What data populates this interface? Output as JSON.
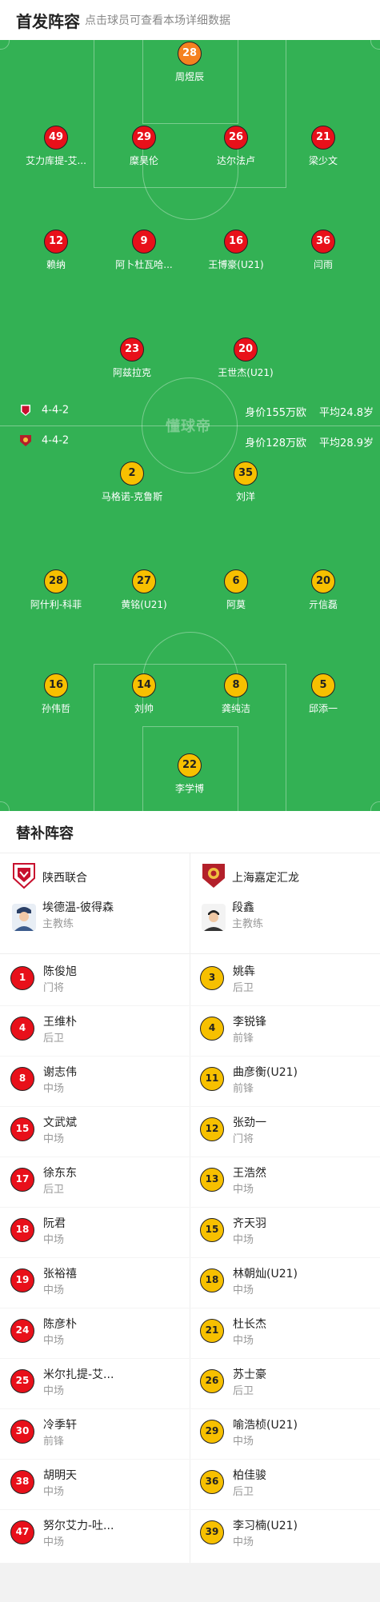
{
  "header": {
    "title": "首发阵容",
    "hint": "点击球员可查看本场详细数据"
  },
  "pitch": {
    "watermark": "懂球帝",
    "home": {
      "formation": "4-4-2",
      "value": "身价155万欧",
      "age": "平均24.8岁",
      "crest_color": "#c8102e"
    },
    "away": {
      "formation": "4-4-2",
      "value": "身价128万欧",
      "age": "平均28.9岁",
      "crest_color": "#b3202a"
    },
    "home_players": [
      {
        "num": "28",
        "name": "周煜辰",
        "color": "orange",
        "ball": false
      },
      {
        "num": "49",
        "name": "艾力库提-艾...",
        "color": "red",
        "ball": false
      },
      {
        "num": "29",
        "name": "糜昊伦",
        "color": "red",
        "ball": true
      },
      {
        "num": "26",
        "name": "达尔法卢",
        "color": "red",
        "ball": true
      },
      {
        "num": "21",
        "name": "梁少文",
        "color": "red",
        "ball": false
      },
      {
        "num": "12",
        "name": "赖纳",
        "color": "red",
        "ball": false
      },
      {
        "num": "9",
        "name": "阿卜杜瓦哈...",
        "color": "red",
        "ball": false
      },
      {
        "num": "16",
        "name": "王博豪(U21)",
        "color": "red",
        "ball": false
      },
      {
        "num": "36",
        "name": "闫雨",
        "color": "red",
        "ball": false
      },
      {
        "num": "23",
        "name": "阿兹拉克",
        "color": "red",
        "ball": false
      },
      {
        "num": "20",
        "name": "王世杰(U21)",
        "color": "red",
        "ball": false
      }
    ],
    "away_players": [
      {
        "num": "2",
        "name": "马格诺-克鲁斯",
        "color": "yellow",
        "ball": false
      },
      {
        "num": "35",
        "name": "刘洋",
        "color": "yellow",
        "ball": false
      },
      {
        "num": "28",
        "name": "阿什利-科菲",
        "color": "yellow",
        "ball": false
      },
      {
        "num": "27",
        "name": "黄铭(U21)",
        "color": "yellow",
        "ball": false
      },
      {
        "num": "6",
        "name": "阿莫",
        "color": "yellow",
        "ball": true
      },
      {
        "num": "20",
        "name": "亓信磊",
        "color": "yellow",
        "ball": false
      },
      {
        "num": "16",
        "name": "孙伟哲",
        "color": "yellow",
        "ball": false
      },
      {
        "num": "14",
        "name": "刘帅",
        "color": "yellow",
        "ball": false
      },
      {
        "num": "8",
        "name": "龚纯洁",
        "color": "yellow",
        "ball": false
      },
      {
        "num": "5",
        "name": "邱添一",
        "color": "yellow",
        "ball": false
      },
      {
        "num": "22",
        "name": "李学博",
        "color": "yellow",
        "ball": false
      }
    ]
  },
  "subs": {
    "title": "替补阵容",
    "home": {
      "team": "陕西联合",
      "coach": {
        "name": "埃德温-彼得森",
        "role": "主教练"
      },
      "players": [
        {
          "num": "1",
          "name": "陈俊旭",
          "pos": "门将"
        },
        {
          "num": "4",
          "name": "王维朴",
          "pos": "后卫"
        },
        {
          "num": "8",
          "name": "谢志伟",
          "pos": "中场"
        },
        {
          "num": "15",
          "name": "文武斌",
          "pos": "中场"
        },
        {
          "num": "17",
          "name": "徐东东",
          "pos": "后卫"
        },
        {
          "num": "18",
          "name": "阮君",
          "pos": "中场"
        },
        {
          "num": "19",
          "name": "张裕禧",
          "pos": "中场"
        },
        {
          "num": "24",
          "name": "陈彦朴",
          "pos": "中场"
        },
        {
          "num": "25",
          "name": "米尔扎提-艾...",
          "pos": "中场"
        },
        {
          "num": "30",
          "name": "冷季轩",
          "pos": "前锋"
        },
        {
          "num": "38",
          "name": "胡明天",
          "pos": "中场"
        },
        {
          "num": "47",
          "name": "努尔艾力-吐...",
          "pos": "中场"
        }
      ]
    },
    "away": {
      "team": "上海嘉定汇龙",
      "coach": {
        "name": "段鑫",
        "role": "主教练"
      },
      "players": [
        {
          "num": "3",
          "name": "姚犇",
          "pos": "后卫"
        },
        {
          "num": "4",
          "name": "李锐锋",
          "pos": "前锋"
        },
        {
          "num": "11",
          "name": "曲彦衡(U21)",
          "pos": "前锋"
        },
        {
          "num": "12",
          "name": "张劲一",
          "pos": "门将"
        },
        {
          "num": "13",
          "name": "王浩然",
          "pos": "中场"
        },
        {
          "num": "15",
          "name": "齐天羽",
          "pos": "中场"
        },
        {
          "num": "18",
          "name": "林朝灿(U21)",
          "pos": "中场"
        },
        {
          "num": "21",
          "name": "杜长杰",
          "pos": "中场"
        },
        {
          "num": "26",
          "name": "苏士豪",
          "pos": "后卫"
        },
        {
          "num": "29",
          "name": "喻浩桢(U21)",
          "pos": "中场"
        },
        {
          "num": "36",
          "name": "柏佳骏",
          "pos": "后卫"
        },
        {
          "num": "39",
          "name": "李习楠(U21)",
          "pos": "中场"
        }
      ]
    }
  }
}
